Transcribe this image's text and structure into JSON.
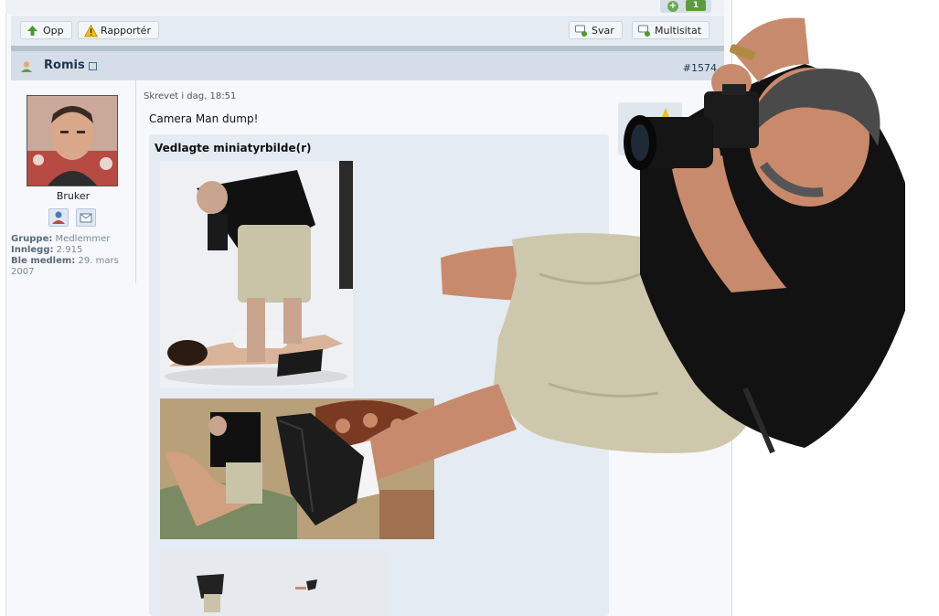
{
  "vote": {
    "count": "1",
    "plus_icon": "plus-circle-icon"
  },
  "toolbar": {
    "up_label": "Opp",
    "report_label": "Rapportér",
    "reply_label": "Svar",
    "multiquote_label": "Multisitat"
  },
  "post": {
    "author": "Romis",
    "number": "#1574",
    "written": "Skrevet i dag, 18:51",
    "body": "Camera Man dump!",
    "attachments_title": "Vedlagte miniatyrbilde(r)"
  },
  "user": {
    "role": "Bruker",
    "group_label": "Gruppe:",
    "group_value": "Medlemmer",
    "posts_label": "Innlegg:",
    "posts_value": "2.915",
    "joined_label": "Ble medlem:",
    "joined_value": "29. mars 2007"
  },
  "colors": {
    "accent": "#1d3652",
    "header_bg": "#d5dee8",
    "vote_green": "#5b9a3e"
  }
}
